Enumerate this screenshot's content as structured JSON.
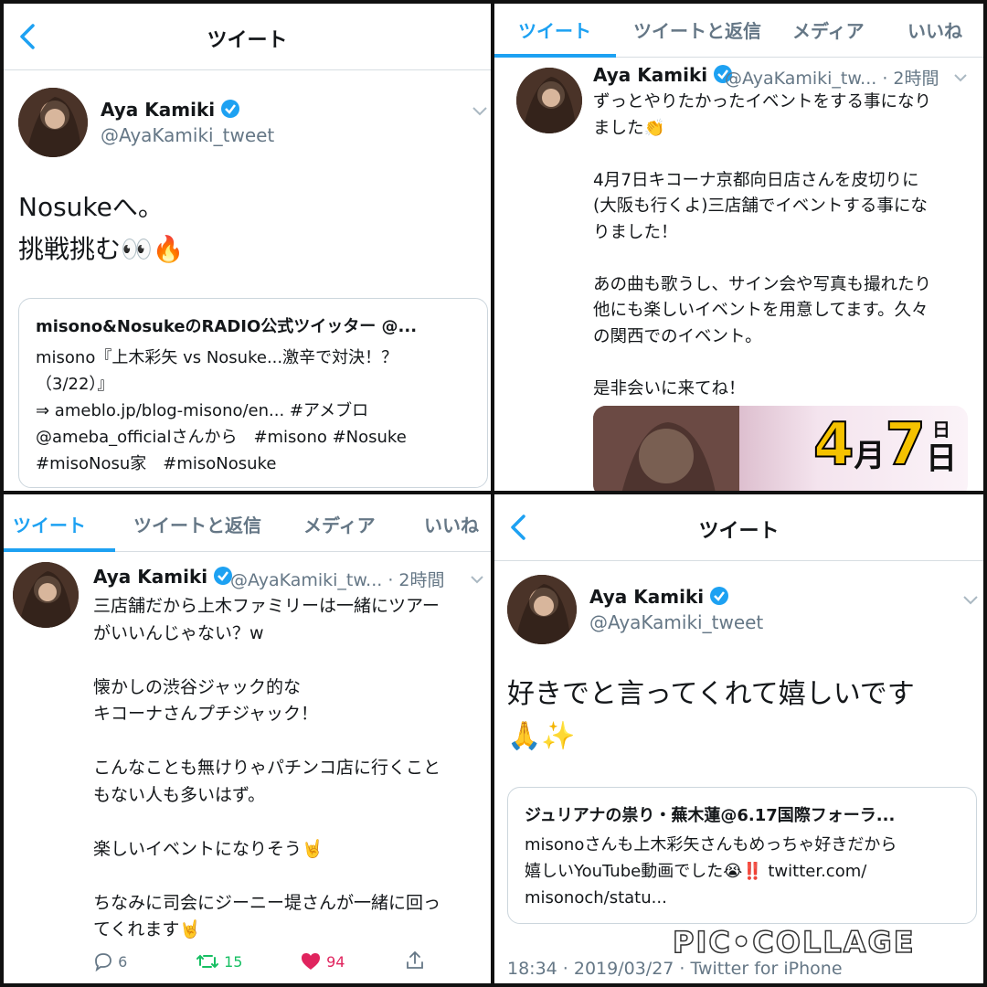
{
  "panel1": {
    "title": "ツイート",
    "name": "Aya Kamiki",
    "handle": "@AyaKamiki_tweet",
    "text": "Nosukeへ。\n挑戦挑む👀🔥",
    "quote": {
      "title": "misono&NosukeのRADIO公式ツイッター @...",
      "body": "misono『上木彩矢 vs Nosuke...激辛で対決！？\n（3/22）』\n⇒ ameblo.jp/blog-misono/en... #アメブロ\n@ameba_officialさんから　#misono #Nosuke\n#misoNosu家　#misoNosuke"
    }
  },
  "panel2": {
    "tabs": [
      "ツイート",
      "ツイートと返信",
      "メディア",
      "いいね"
    ],
    "name": "Aya Kamiki",
    "handle_time": "@AyaKamiki_tw... · 2時間",
    "text": "ずっとやりたかったイベントをする事になり\nました👏\n\n4月7日キコーナ京都向日店さんを皮切りに\n(大阪も行くよ)三店舗でイベントする事にな\nりました！\n\nあの曲も歌うし、サイン会や写真も撮れたり\n他にも楽しいイベントを用意してます。久々\nの関西でのイベント。\n\n是非会いに来てね！",
    "banner_text": "4月7日",
    "banner_month_day": [
      "4",
      "月",
      "7"
    ],
    "banner_weekday_small": "日",
    "banner_weekday_big": "日"
  },
  "panel3": {
    "tabs": [
      "ツイート",
      "ツイートと返信",
      "メディア",
      "いいね"
    ],
    "name": "Aya Kamiki",
    "handle_time": "@AyaKamiki_tw... · 2時間",
    "text": "三店舗だから上木ファミリーは一緒にツアー\nがいいんじゃない？w\n\n懐かしの渋谷ジャック的な\nキコーナさんプチジャック！\n\nこんなことも無けりゃパチンコ店に行くこと\nもない人も多いはず。\n\n楽しいイベントになりそう🤘\n\nちなみに司会にジーニー堤さんが一緒に回っ\nてくれます🤘",
    "replies": "6",
    "retweets": "15",
    "likes": "94"
  },
  "panel4": {
    "title": "ツイート",
    "name": "Aya Kamiki",
    "handle": "@AyaKamiki_tweet",
    "text": "好きでと言ってくれて嬉しいです\n🙏✨",
    "quote": {
      "title": "ジュリアナの祟り・蕪木蓮@6.17国際フォーラ...",
      "body": "misonoさんも上木彩矢さんもめっちゃ好きだから\n嬉しいYouTube動画でした😭‼️ twitter.com/\nmisonoch/statu..."
    },
    "footer": "18:34 · 2019/03/27 · Twitter for iPhone"
  },
  "watermark": "PIC•COLLAGE",
  "colors": {
    "accent": "#1da1f2",
    "like": "#e0245e",
    "retweet": "#17bf63",
    "muted": "#657786"
  }
}
